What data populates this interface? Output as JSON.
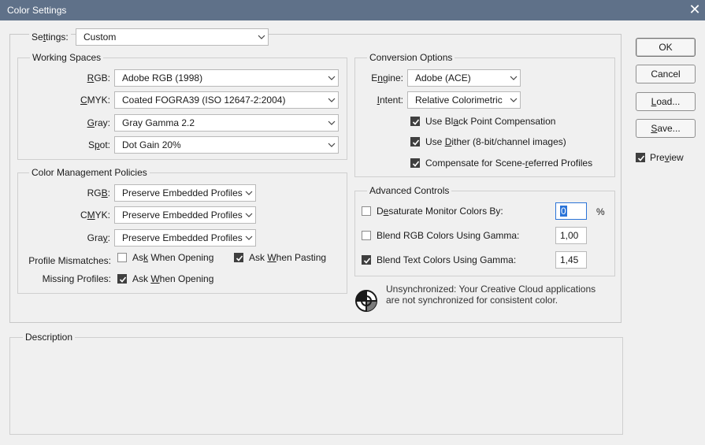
{
  "window": {
    "title": "Color Settings"
  },
  "settings": {
    "label_pre": "Se",
    "label_u": "t",
    "label_post": "tings:",
    "value": "Custom"
  },
  "working_spaces": {
    "legend": "Working Spaces",
    "rgb": {
      "label_u": "R",
      "label_post": "GB:",
      "value": "Adobe RGB (1998)"
    },
    "cmyk": {
      "label_u": "C",
      "label_post": "MYK:",
      "value": "Coated FOGRA39 (ISO 12647-2:2004)"
    },
    "gray": {
      "label_u": "G",
      "label_post": "ray:",
      "value": "Gray Gamma 2.2"
    },
    "spot": {
      "label_pre": "S",
      "label_u": "p",
      "label_post": "ot:",
      "value": "Dot Gain 20%"
    }
  },
  "policies": {
    "legend": "Color Management Policies",
    "rgb": {
      "label_pre": "RG",
      "label_u": "B",
      "label_post": ":",
      "value": "Preserve Embedded Profiles"
    },
    "cmyk": {
      "label_pre": "C",
      "label_u": "M",
      "label_post": "YK:",
      "value": "Preserve Embedded Profiles"
    },
    "gray": {
      "label_pre": "Gra",
      "label_u": "y",
      "label_post": ":",
      "value": "Preserve Embedded Profiles"
    },
    "mismatch_label": "Profile Mismatches:",
    "mismatch_open": {
      "pre": "As",
      "u": "k",
      "post": " When Opening",
      "checked": false
    },
    "mismatch_paste": {
      "pre": "Ask ",
      "u": "W",
      "post": "hen Pasting",
      "checked": true
    },
    "missing_label": "Missing Profiles:",
    "missing_open": {
      "pre": "Ask ",
      "u": "W",
      "post": "hen Opening",
      "checked": true
    }
  },
  "conversion": {
    "legend": "Conversion Options",
    "engine": {
      "label_pre": "E",
      "label_u": "n",
      "label_post": "gine:",
      "value": "Adobe (ACE)"
    },
    "intent": {
      "label_u": "I",
      "label_post": "ntent:",
      "value": "Relative Colorimetric"
    },
    "black_point": {
      "pre": "Use Bl",
      "u": "a",
      "post": "ck Point Compensation",
      "checked": true
    },
    "dither": {
      "pre": "Use ",
      "u": "D",
      "post": "ither (8-bit/channel images)",
      "checked": true
    },
    "scene": {
      "pre": "Compensate for Scene-",
      "u": "r",
      "post": "eferred Profiles",
      "checked": true
    }
  },
  "advanced": {
    "legend": "Advanced Controls",
    "desaturate": {
      "pre": "D",
      "u": "e",
      "post": "saturate Monitor Colors By:",
      "checked": false,
      "value": "0",
      "unit": "%"
    },
    "blend_rgb": {
      "text": "Blend RGB Colors Using Gamma:",
      "checked": false,
      "value": "1,00"
    },
    "blend_text": {
      "text": "Blend Text Colors Using Gamma:",
      "checked": true,
      "value": "1,45"
    }
  },
  "sync": {
    "icon": "sync-warning-icon",
    "line1": "Unsynchronized: Your Creative Cloud applications",
    "line2": "are not synchronized for consistent color."
  },
  "description": {
    "legend": "Description"
  },
  "buttons": {
    "ok": "OK",
    "cancel": "Cancel",
    "load": {
      "pre": "",
      "u": "L",
      "post": "oad..."
    },
    "save": {
      "pre": "",
      "u": "S",
      "post": "ave..."
    },
    "preview": {
      "pre": "Pre",
      "u": "v",
      "post": "iew",
      "checked": true
    }
  },
  "colors": {
    "titlebar": "#5f7189",
    "accent": "#2b74d8",
    "checkbox": "#3f3f3f"
  }
}
